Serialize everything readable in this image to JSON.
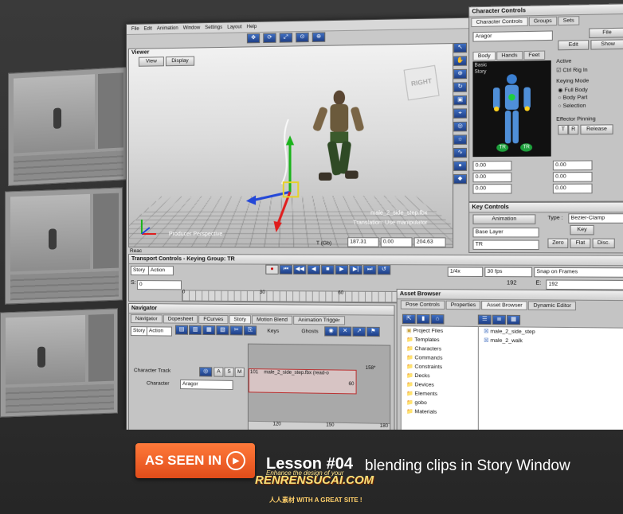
{
  "menu": [
    "File",
    "Edit",
    "Animation",
    "Window",
    "Settings",
    "Layout",
    "Help"
  ],
  "viewer": {
    "title": "Viewer",
    "view_label": "View",
    "display_label": "Display",
    "clip_label": "male_2_side_step.fbx",
    "status_label": "Translation: Use manipulator",
    "perspective_label": "Producer Perspective",
    "cube_label": "RIGHT",
    "ready_label": "Reac",
    "coords": {
      "label": "T (Gb)",
      "x": "187.31",
      "y": "0.00",
      "z": "204.63"
    }
  },
  "character_controls": {
    "title": "Character Controls",
    "tabs": [
      "Character Controls",
      "Groups",
      "Sets"
    ],
    "character": "Aragor",
    "file_label": "File",
    "edit_label": "Edit",
    "show_label": "Show",
    "subtabs": [
      "Body",
      "Hands",
      "Feet"
    ],
    "basic_label": "Basic",
    "story_label": "Story",
    "active_label": "Active",
    "ctrl_rig_label": "Ctrl Rig In",
    "keying_mode_label": "Keying Mode",
    "modes": [
      "Full Body",
      "Body Part",
      "Selection"
    ],
    "effector_pinning_label": "Effector Pinning",
    "pin_t": "T",
    "pin_r": "R",
    "release_label": "Release",
    "tr_marks": [
      "TR",
      "TR"
    ],
    "values": [
      "0.00",
      "0.00",
      "0.00",
      "0.00",
      "0.00",
      "0.00"
    ]
  },
  "key_controls": {
    "title": "Key Controls",
    "animation_label": "Animation",
    "type_label": "Type :",
    "type_value": "Bezier-Clamp",
    "key_label": "Key",
    "base_layer_label": "Base Layer",
    "zero_label": "Zero",
    "flat_label": "Flat",
    "disc_label": "Disc.",
    "tr_label": "TR"
  },
  "transport": {
    "title": "Transport Controls - Keying Group: TR",
    "story_label": "Story",
    "action_label": "Action",
    "speed": "1/4x",
    "fps": "30 fps",
    "snap": "Snap on Frames",
    "frame_end": "192",
    "e_label": "E:",
    "e_value": "192",
    "s_label": "S:",
    "s_value": "0",
    "ruler": [
      "0",
      "30",
      "60",
      "90",
      "120",
      "150"
    ]
  },
  "navigator": {
    "title": "Navigator",
    "tabs": [
      "Navigator",
      "Dopesheet",
      "FCurves",
      "Story",
      "Motion Blend",
      "Animation Trigger"
    ],
    "story_label": "Story",
    "action_label": "Action",
    "keys_label": "Keys",
    "ghosts_label": "Ghosts",
    "track_label": "Character Track",
    "character_label": "Character",
    "character_value": "Aragor",
    "track_buttons": [
      "A",
      "S",
      "M"
    ],
    "clip_label": "male_2_side_step.fbx (read-o",
    "clip_frame_a": "158*",
    "clip_frame_b": "60",
    "clip_start": "101",
    "ruler": [
      "120",
      "150",
      "180"
    ]
  },
  "asset_browser": {
    "title": "Asset Browser",
    "tabs": [
      "Pose Controls",
      "Properties",
      "Asset Browser",
      "Dynamic Editor"
    ],
    "tree": [
      "Project Files",
      "Templates",
      "Characters",
      "Commands",
      "Constraints",
      "Decks",
      "Devices",
      "Elements",
      "gobo",
      "Materials"
    ],
    "files": [
      "male_2_side_step",
      "male_2_walk"
    ]
  },
  "banner": {
    "badge_label": "AS SEEN IN",
    "lesson_label": "Lesson #04",
    "lesson_desc": "blending clips in Story Window",
    "watermark_top": "Enhance the design of your",
    "watermark": "RENRENSUCAI.COM",
    "watermark_sub": "人人素材  WITH A GREAT SITE !"
  },
  "colors": {
    "accent": "#e35a20",
    "tab_blue": "#3a6bc0",
    "panel": "#c9c9c9"
  }
}
